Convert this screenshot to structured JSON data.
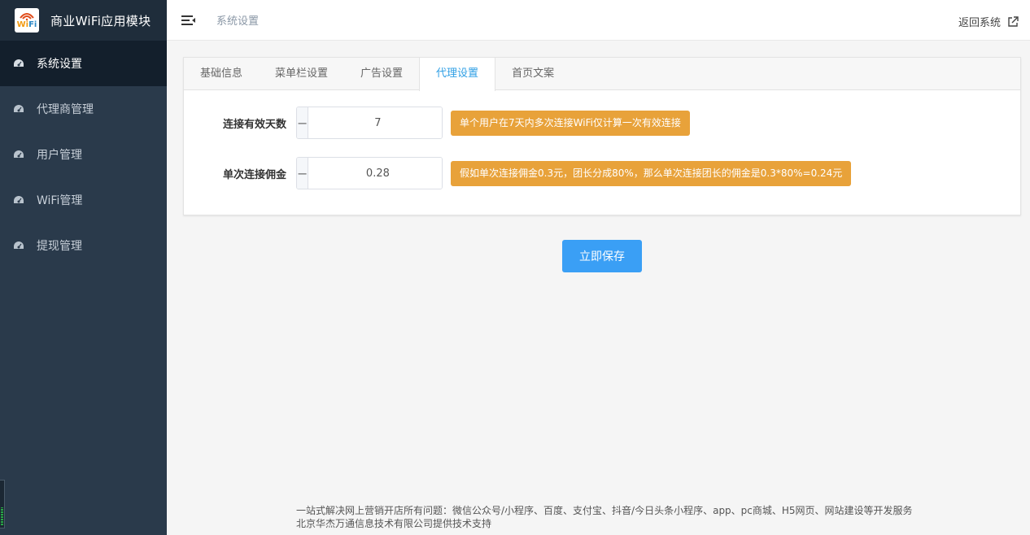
{
  "app": {
    "title": "商业WiFi应用模块",
    "logo_text_top": "Wi",
    "logo_text_accent": "Fi"
  },
  "sidebar": {
    "items": [
      {
        "label": "系统设置",
        "icon": "dashboard-icon",
        "active": true
      },
      {
        "label": "代理商管理",
        "icon": "dashboard-icon",
        "active": false
      },
      {
        "label": "用户管理",
        "icon": "dashboard-icon",
        "active": false
      },
      {
        "label": "WiFi管理",
        "icon": "dashboard-icon",
        "active": false
      },
      {
        "label": "提现管理",
        "icon": "dashboard-icon",
        "active": false
      }
    ]
  },
  "header": {
    "breadcrumb": "系统设置",
    "return_label": "返回系统"
  },
  "tabs": [
    {
      "label": "基础信息",
      "active": false
    },
    {
      "label": "菜单栏设置",
      "active": false
    },
    {
      "label": "广告设置",
      "active": false
    },
    {
      "label": "代理设置",
      "active": true
    },
    {
      "label": "首页文案",
      "active": false
    }
  ],
  "form": {
    "days": {
      "label": "连接有效天数",
      "value": "7",
      "minus": "−",
      "plus": "+",
      "hint": "单个用户在7天内多次连接WiFi仅计算一次有效连接"
    },
    "commission": {
      "label": "单次连接佣金",
      "value": "0.28",
      "minus": "−",
      "plus": "+",
      "hint": "假如单次连接佣金0.3元，团长分成80%，那么单次连接团长的佣金是0.3*80%=0.24元"
    }
  },
  "save_label": "立即保存",
  "footer": {
    "line1": "一站式解决网上营销开店所有问题：微信公众号/小程序、百度、支付宝、抖音/今日头条小程序、app、pc商城、H5网页、网站建设等开发服务",
    "line2": "北京华杰万通信息技术有限公司提供技术支持"
  },
  "colors": {
    "sidebar_bg": "#2a3a4b",
    "sidebar_active": "#131f2c",
    "accent": "#2f9fe5",
    "hint_bg": "#e8a23a",
    "save_bg": "#3a9ff5"
  }
}
